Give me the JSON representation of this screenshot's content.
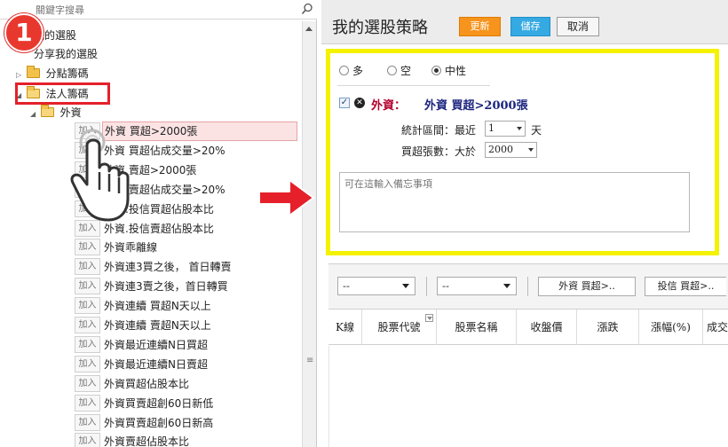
{
  "step_badge": "1",
  "left": {
    "search_placeholder": "關鍵字搜尋",
    "tree": [
      {
        "label": "我的選股",
        "indent": 0,
        "folder": false
      },
      {
        "label": "分享我的選股",
        "indent": 0,
        "folder": false
      },
      {
        "label": "分點籌碼",
        "indent": 0,
        "folder": true
      },
      {
        "label": "法人籌碼",
        "indent": 0,
        "folder": true
      },
      {
        "label": "外資",
        "indent": 1,
        "folder": true
      }
    ],
    "add_label": "加入",
    "strategies": [
      "外資 買超>2000張",
      "外資 買超佔成交量>20%",
      "外資 賣超>2000張",
      "外資 賣超佔成交量>20%",
      "外資.投信買超佔股本比",
      "外資.投信賣超佔股本比",
      "外資乖離線",
      "外資連3買之後， 首日轉賣",
      "外資連3賣之後，首日轉買",
      "外資連續 買超N天以上",
      "外資連續 賣超N天以上",
      "外資最近連續N日買超",
      "外資最近連續N日賣超",
      "外資買超佔股本比",
      "外資買賣超創60日新低",
      "外資買賣超創60日新高",
      "外資賣超佔股本比"
    ]
  },
  "right": {
    "title": "我的選股策略",
    "buttons": {
      "update": "更新",
      "save": "儲存",
      "cancel": "取消"
    },
    "radios": [
      {
        "label": "多",
        "checked": false
      },
      {
        "label": "空",
        "checked": false
      },
      {
        "label": "中性",
        "checked": true
      }
    ],
    "condition": {
      "checked": true,
      "category": "外資：",
      "name": "外資 買超>2000張"
    },
    "params": {
      "period_label": "統計區間：最近",
      "period_value": "1",
      "period_unit": "天",
      "volume_label": "買超張數：大於",
      "volume_value": "2000"
    },
    "memo_placeholder": "可在這輸入備忘事項",
    "filters": {
      "select1": "--",
      "select2": "--",
      "btn1": "外資 買超>..",
      "btn2": "投信 買超>.."
    },
    "columns": [
      "K線",
      "股票代號",
      "股票名稱",
      "收盤價",
      "漲跌",
      "漲幅(%)",
      "成交量"
    ]
  },
  "colors": {
    "highlight_red": "#e5202a",
    "yellow_frame": "#f5f200",
    "update_orange": "#f7941d",
    "save_blue": "#35a9e2",
    "category_red": "#b3002d",
    "condition_navy": "#1a237e"
  },
  "icons": [
    "search-icon",
    "folder-icon",
    "close-icon",
    "hand-cursor-icon",
    "red-arrow-icon",
    "sort-icon"
  ]
}
